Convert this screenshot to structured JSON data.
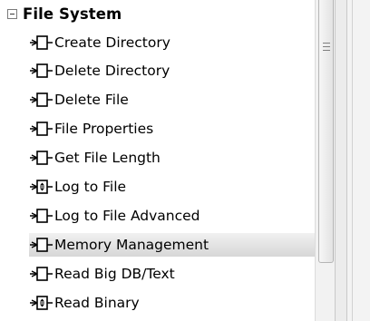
{
  "tree": {
    "group": {
      "label": "File System",
      "icon": "collapse-minus-icon"
    },
    "items": [
      {
        "label": "Create Directory",
        "icon": "block-node-icon"
      },
      {
        "label": "Delete Directory",
        "icon": "block-node-icon"
      },
      {
        "label": "Delete File",
        "icon": "block-node-icon"
      },
      {
        "label": "File Properties",
        "icon": "block-node-icon"
      },
      {
        "label": "Get File Length",
        "icon": "block-node-icon"
      },
      {
        "label": "Log to File",
        "icon": "expandable-block-node-icon"
      },
      {
        "label": "Log to File Advanced",
        "icon": "block-node-icon"
      },
      {
        "label": "Memory Management",
        "icon": "block-node-icon",
        "selected": true
      },
      {
        "label": "Read Big DB/Text",
        "icon": "block-node-icon"
      },
      {
        "label": "Read Binary",
        "icon": "expandable-block-node-icon"
      }
    ]
  },
  "scrollbar": {
    "grip_icon": "grip-lines-icon"
  },
  "colors": {
    "selection": "#dcdcdc",
    "thumb_border": "#b5b5b5"
  }
}
